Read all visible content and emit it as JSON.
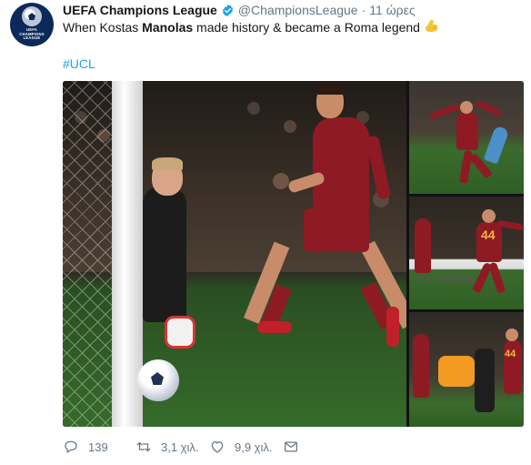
{
  "tweet": {
    "display_name": "UEFA Champions League",
    "handle": "@ChampionsLeague",
    "separator": "·",
    "time": "11 ώρες",
    "text_before": "When Kostas ",
    "text_bold": "Manolas",
    "text_after": " made history & became a Roma legend",
    "hashtag": "#UCL",
    "avatar_logo_text": [
      "UEFA",
      "CHAMPIONS",
      "LEAGUE"
    ],
    "photo_side2_ad_text": "DY  XERIA",
    "player_number": "44",
    "emoji": "flexed-biceps"
  },
  "actions": {
    "reply_count": "139",
    "retweet_count": "3,1 χιλ.",
    "like_count": "9,9 χιλ."
  },
  "colors": {
    "link": "#1da1f2",
    "secondary_text": "#657786",
    "verified": "#1da1f2",
    "roma_red": "#8e1b24"
  }
}
